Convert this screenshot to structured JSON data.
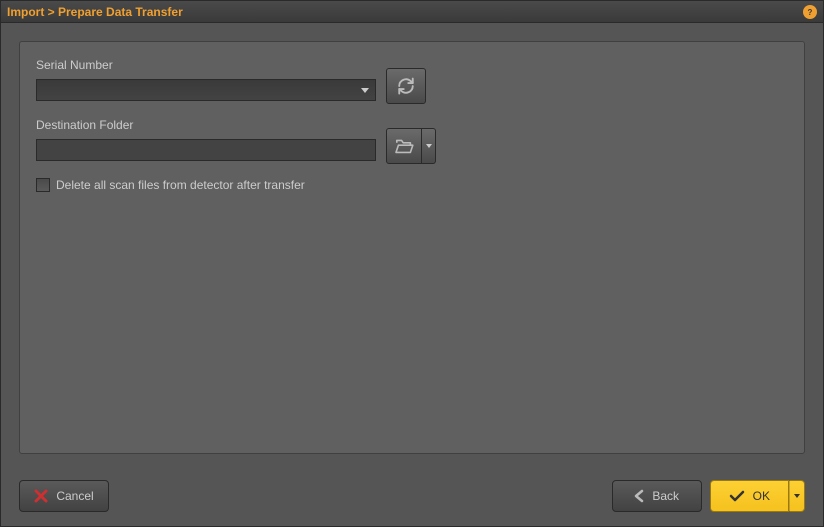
{
  "title": "Import > Prepare Data Transfer",
  "fields": {
    "serial": {
      "label": "Serial Number",
      "value": ""
    },
    "destination": {
      "label": "Destination Folder",
      "value": ""
    }
  },
  "checkbox": {
    "delete_label": "Delete all scan files from detector after transfer",
    "checked": false
  },
  "buttons": {
    "cancel": "Cancel",
    "back": "Back",
    "ok": "OK"
  }
}
